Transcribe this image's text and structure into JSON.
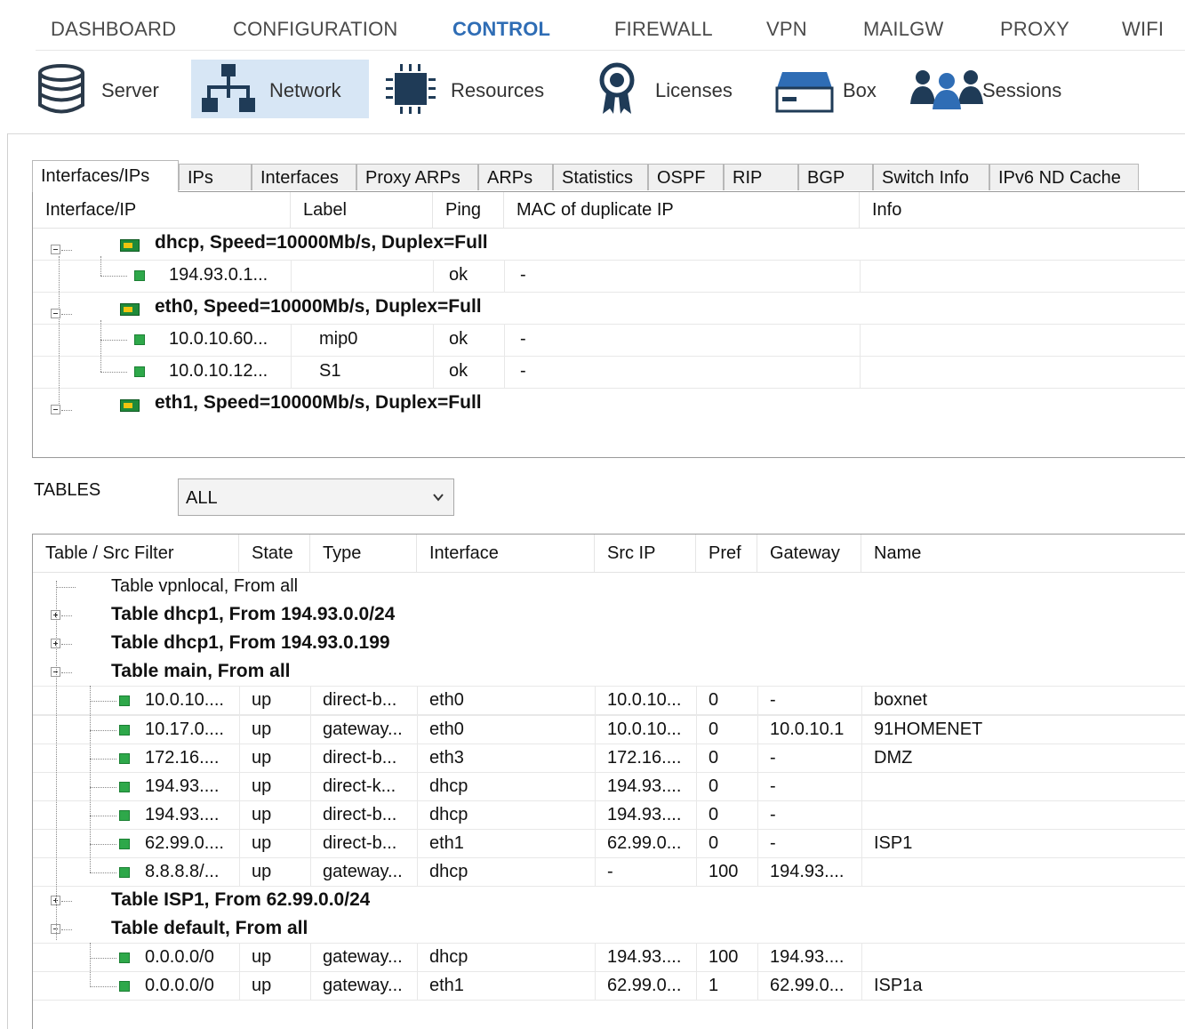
{
  "top_nav": {
    "items": [
      {
        "label": "DASHBOARD",
        "active": false
      },
      {
        "label": "CONFIGURATION",
        "active": false
      },
      {
        "label": "CONTROL",
        "active": true
      },
      {
        "label": "FIREWALL",
        "active": false
      },
      {
        "label": "VPN",
        "active": false
      },
      {
        "label": "MAILGW",
        "active": false
      },
      {
        "label": "PROXY",
        "active": false
      },
      {
        "label": "WIFI",
        "active": false
      }
    ],
    "active_color": "#2f6db5"
  },
  "toolbar": {
    "items": [
      {
        "label": "Server",
        "icon": "database-icon",
        "active": false
      },
      {
        "label": "Network",
        "icon": "network-icon",
        "active": true
      },
      {
        "label": "Resources",
        "icon": "chip-icon",
        "active": false
      },
      {
        "label": "Licenses",
        "icon": "badge-icon",
        "active": false
      },
      {
        "label": "Box",
        "icon": "box-icon",
        "active": false
      },
      {
        "label": "Sessions",
        "icon": "users-icon",
        "active": false
      }
    ],
    "active_bg": "#d7e6f5"
  },
  "tabs": [
    {
      "label": "Interfaces/IPs",
      "active": true
    },
    {
      "label": "IPs",
      "active": false
    },
    {
      "label": "Interfaces",
      "active": false
    },
    {
      "label": "Proxy ARPs",
      "active": false
    },
    {
      "label": "ARPs",
      "active": false
    },
    {
      "label": "Statistics",
      "active": false
    },
    {
      "label": "OSPF",
      "active": false
    },
    {
      "label": "RIP",
      "active": false
    },
    {
      "label": "BGP",
      "active": false
    },
    {
      "label": "Switch Info",
      "active": false
    },
    {
      "label": "IPv6 ND Cache",
      "active": false
    }
  ],
  "ip_grid": {
    "columns": [
      "Interface/IP",
      "Label",
      "Ping",
      "MAC of duplicate IP",
      "Info"
    ],
    "rows": [
      {
        "kind": "group",
        "text": "dhcp, Speed=10000Mb/s, Duplex=Full",
        "expanded": true
      },
      {
        "kind": "child",
        "ip": "194.93.0.1...",
        "label": "",
        "ping": "ok",
        "mac": "-",
        "info": "",
        "last": true
      },
      {
        "kind": "group",
        "text": "eth0, Speed=10000Mb/s, Duplex=Full",
        "expanded": true
      },
      {
        "kind": "child",
        "ip": "10.0.10.60...",
        "label": "mip0",
        "ping": "ok",
        "mac": "-",
        "info": "",
        "last": false
      },
      {
        "kind": "child",
        "ip": "10.0.10.12...",
        "label": "S1",
        "ping": "ok",
        "mac": "-",
        "info": "",
        "last": true
      },
      {
        "kind": "group",
        "text": "eth1, Speed=10000Mb/s, Duplex=Full",
        "expanded": true
      }
    ],
    "status_color": "#2ea84a"
  },
  "tables_filter": {
    "label": "TABLES",
    "selected": "ALL"
  },
  "route_grid": {
    "columns": [
      "Table / Src Filter",
      "State",
      "Type",
      "Interface",
      "Src IP",
      "Pref",
      "Gateway",
      "Name"
    ],
    "rows": [
      {
        "kind": "group",
        "text": "Table vpnlocal, From all",
        "bold": false,
        "expander": "none"
      },
      {
        "kind": "group",
        "text": "Table dhcp1, From 194.93.0.0/24",
        "bold": true,
        "expander": "plus"
      },
      {
        "kind": "group",
        "text": "Table dhcp1, From 194.93.0.199",
        "bold": true,
        "expander": "plus"
      },
      {
        "kind": "group",
        "text": "Table main, From all",
        "bold": true,
        "expander": "minus"
      },
      {
        "kind": "child",
        "cells": [
          "10.0.10....",
          "up",
          "direct-b...",
          "eth0",
          "10.0.10...",
          "0",
          "-",
          "boxnet"
        ],
        "last": false
      },
      {
        "kind": "child",
        "cells": [
          "10.17.0....",
          "up",
          "gateway...",
          "eth0",
          "10.0.10...",
          "0",
          "10.0.10.1",
          "91HOMENET"
        ],
        "last": false
      },
      {
        "kind": "child",
        "cells": [
          "172.16....",
          "up",
          "direct-b...",
          "eth3",
          "172.16....",
          "0",
          "-",
          "DMZ"
        ],
        "last": false
      },
      {
        "kind": "child",
        "cells": [
          "194.93....",
          "up",
          "direct-k...",
          "dhcp",
          "194.93....",
          "0",
          "-",
          ""
        ],
        "last": false
      },
      {
        "kind": "child",
        "cells": [
          "194.93....",
          "up",
          "direct-b...",
          "dhcp",
          "194.93....",
          "0",
          "-",
          ""
        ],
        "last": false
      },
      {
        "kind": "child",
        "cells": [
          "62.99.0....",
          "up",
          "direct-b...",
          "eth1",
          "62.99.0...",
          "0",
          "-",
          "ISP1"
        ],
        "last": false
      },
      {
        "kind": "child",
        "cells": [
          "8.8.8.8/...",
          "up",
          "gateway...",
          "dhcp",
          "-",
          "100",
          "194.93....",
          ""
        ],
        "last": true
      },
      {
        "kind": "group",
        "text": "Table ISP1, From 62.99.0.0/24",
        "bold": true,
        "expander": "plus"
      },
      {
        "kind": "group",
        "text": "Table default, From all",
        "bold": true,
        "expander": "minus"
      },
      {
        "kind": "child",
        "cells": [
          "0.0.0.0/0",
          "up",
          "gateway...",
          "dhcp",
          "194.93....",
          "100",
          "194.93....",
          ""
        ],
        "last": false
      },
      {
        "kind": "child",
        "cells": [
          "0.0.0.0/0",
          "up",
          "gateway...",
          "eth1",
          "62.99.0...",
          "1",
          "62.99.0...",
          "ISP1a"
        ],
        "last": true
      }
    ]
  }
}
